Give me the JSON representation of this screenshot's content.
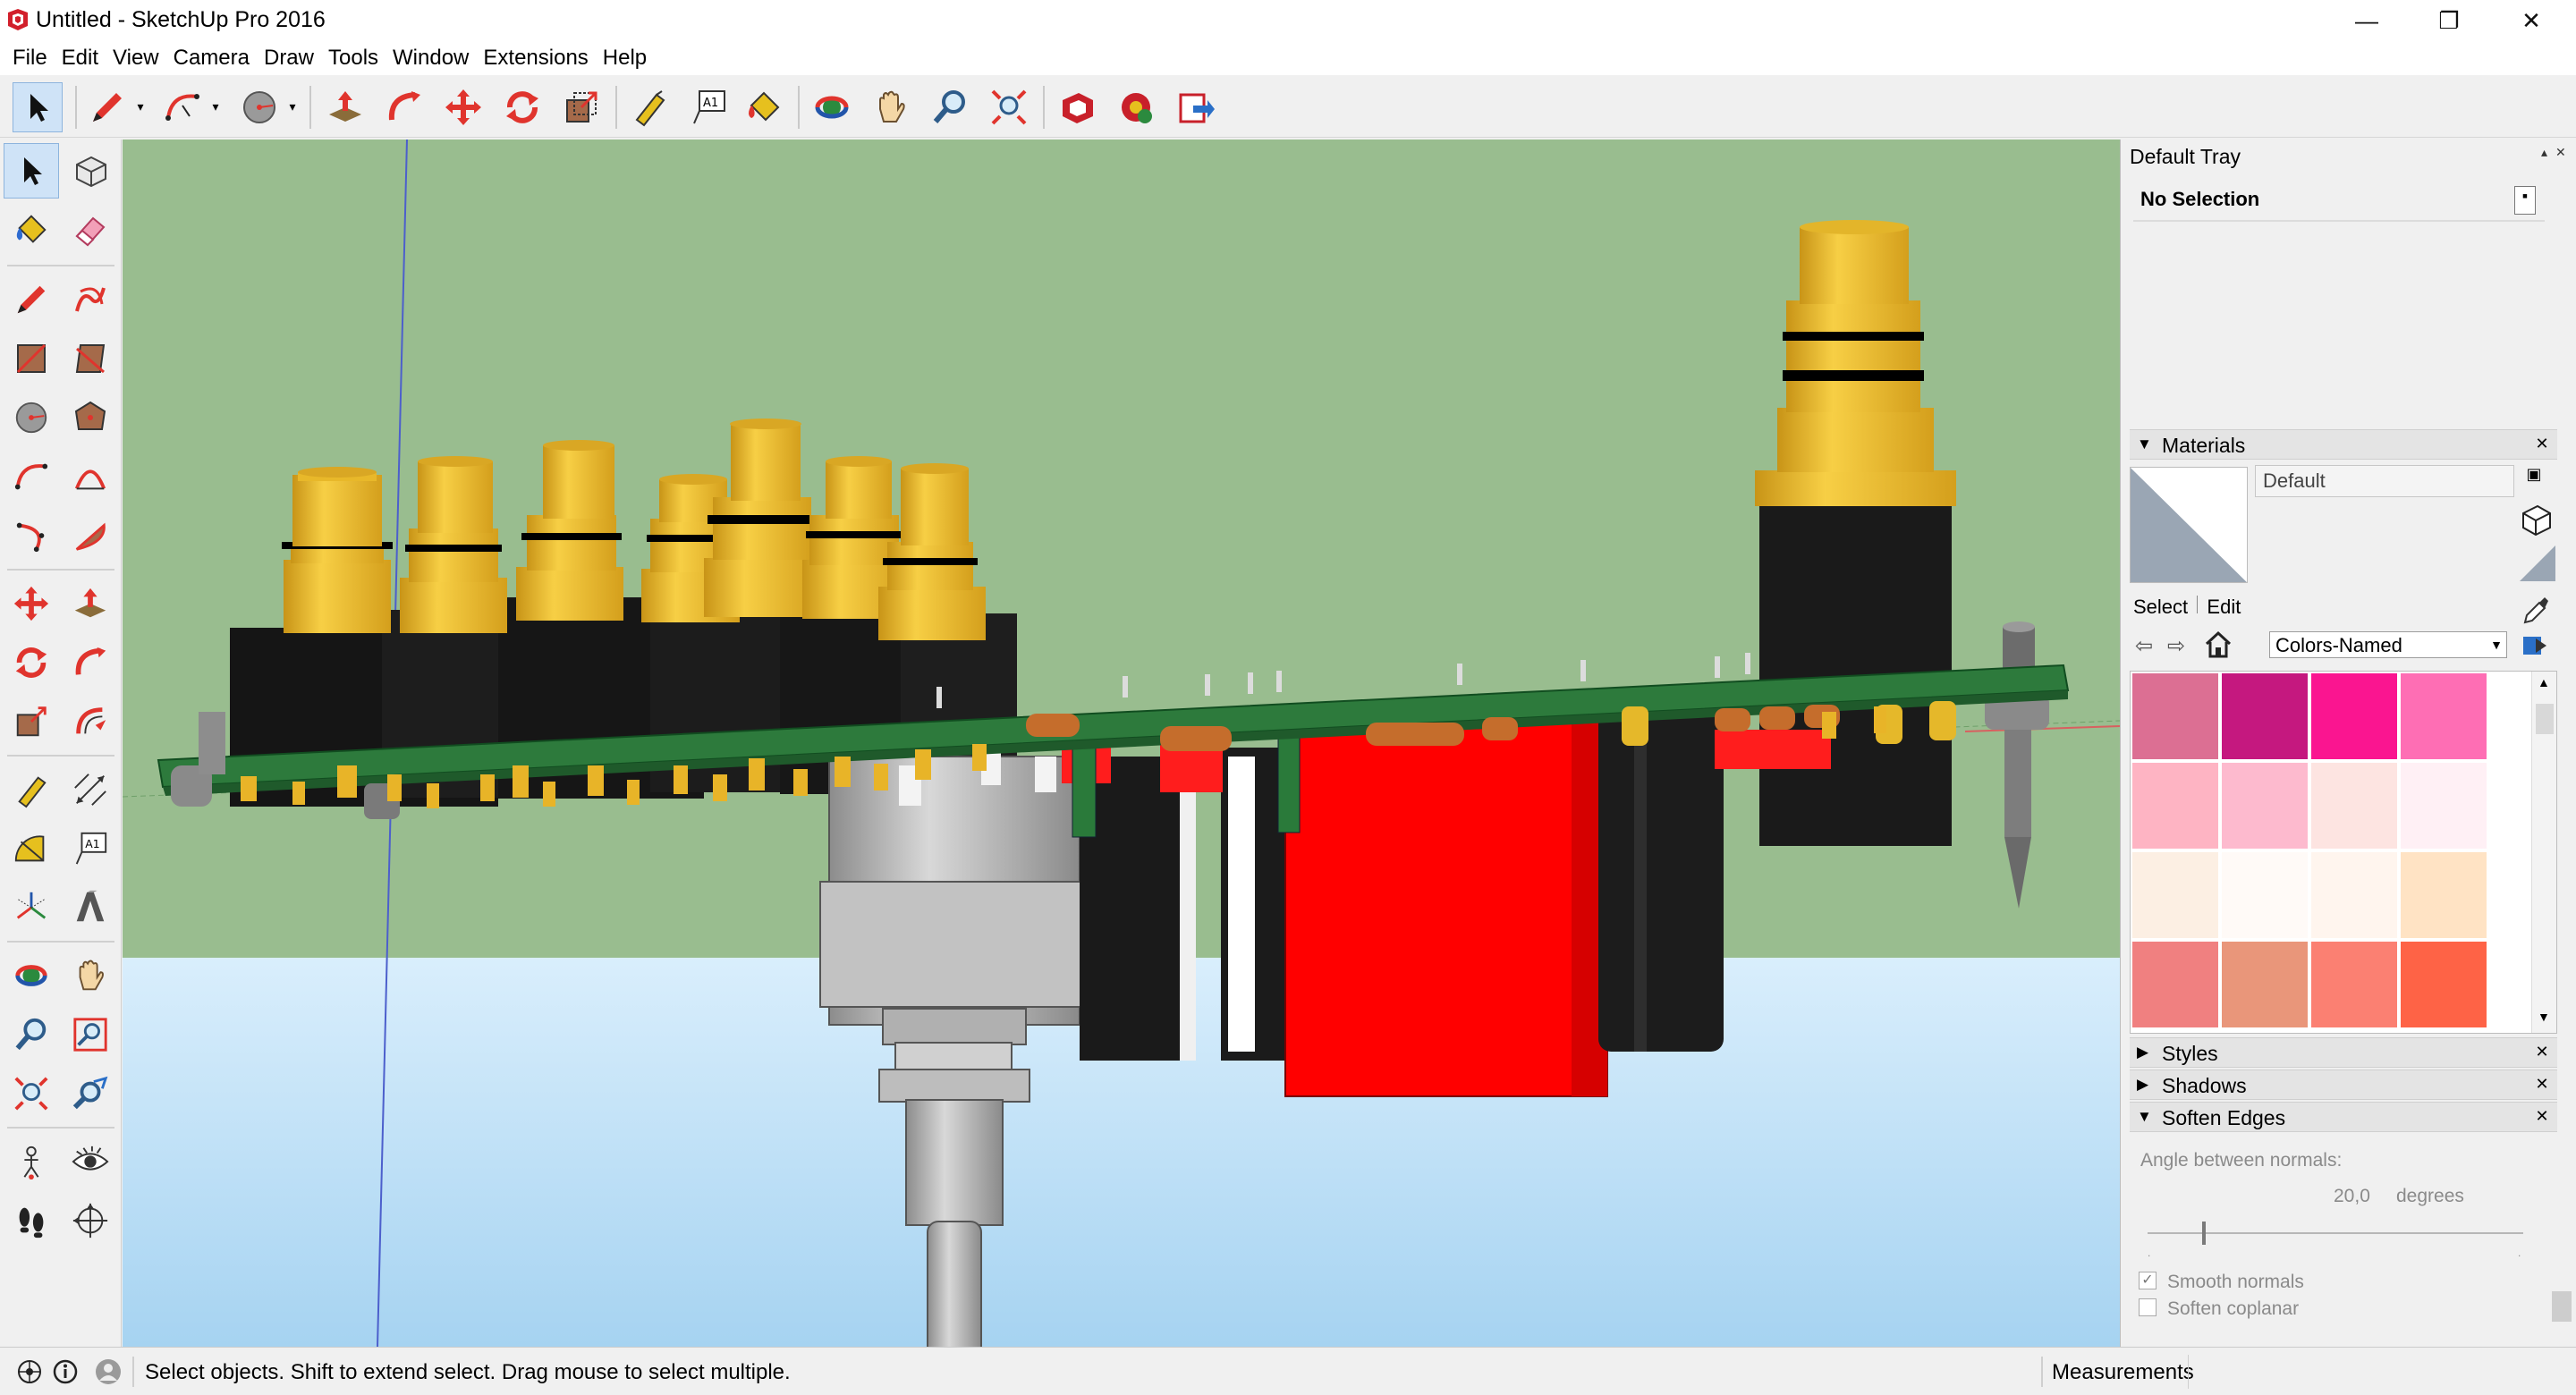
{
  "window": {
    "title": "Untitled - SketchUp Pro 2016",
    "minimize": "—",
    "restore": "❐",
    "close": "✕"
  },
  "menu": [
    "File",
    "Edit",
    "View",
    "Camera",
    "Draw",
    "Tools",
    "Window",
    "Extensions",
    "Help"
  ],
  "top_toolbar": {
    "tools": [
      "select",
      "pencil",
      "arc",
      "circle",
      "push-pull",
      "follow-me",
      "move",
      "rotate",
      "scale",
      "tape-measure",
      "text",
      "paint-bucket",
      "orbit",
      "pan",
      "zoom",
      "zoom-extents",
      "3d-warehouse",
      "extension-warehouse",
      "send-to-layout"
    ],
    "text_tool_label": "A1"
  },
  "left_toolbar": {
    "tools": [
      "select",
      "make-component",
      "paint-bucket",
      "eraser",
      "line",
      "freehand",
      "rectangle",
      "rotated-rectangle",
      "circle",
      "polygon",
      "arc",
      "two-point-arc",
      "three-point-arc",
      "pie",
      "move",
      "push-pull",
      "rotate",
      "follow-me",
      "scale",
      "offset",
      "tape-measure",
      "dimension",
      "protractor",
      "text",
      "axes",
      "3d-text",
      "orbit",
      "pan",
      "zoom",
      "zoom-window",
      "zoom-extents",
      "previous",
      "position-camera",
      "look-around",
      "walk",
      "section-plane"
    ],
    "text_tool_label": "A1"
  },
  "tray": {
    "title": "Default Tray",
    "entity_info": "No Selection",
    "materials": {
      "title": "Materials",
      "name": "Default",
      "tab_select": "Select",
      "tab_edit": "Edit",
      "library": "Colors-Named",
      "swatches": [
        "#dc6f93",
        "#c5187f",
        "#fa1590",
        "#fe6eb4",
        "#feb4c3",
        "#fdbace",
        "#fde4e1",
        "#fff0f5",
        "#fcefe3",
        "#fffaf7",
        "#fff5ee",
        "#ffe3c4",
        "#f08080",
        "#e9967a",
        "#fb8072",
        "#fe6346"
      ]
    },
    "panels": {
      "styles": "Styles",
      "shadows": "Shadows",
      "soften_edges": "Soften Edges"
    },
    "soften": {
      "angle_label": "Angle between normals:",
      "angle_value": "20,0",
      "angle_unit": "degrees",
      "angle_slider_fraction": 0.15,
      "smooth_normals": "Smooth normals",
      "smooth_checked": true,
      "soften_coplanar": "Soften coplanar",
      "coplanar_checked": false
    }
  },
  "status": {
    "hint": "Select objects. Shift to extend select. Drag mouse to select multiple.",
    "measurements_label": "Measurements"
  },
  "colors": {
    "sky": "#99bd8f",
    "ground": "#bfe1f7",
    "pcb": "#2d7a3c",
    "gold": "#f2bd2c",
    "relay": "#ff0000"
  }
}
